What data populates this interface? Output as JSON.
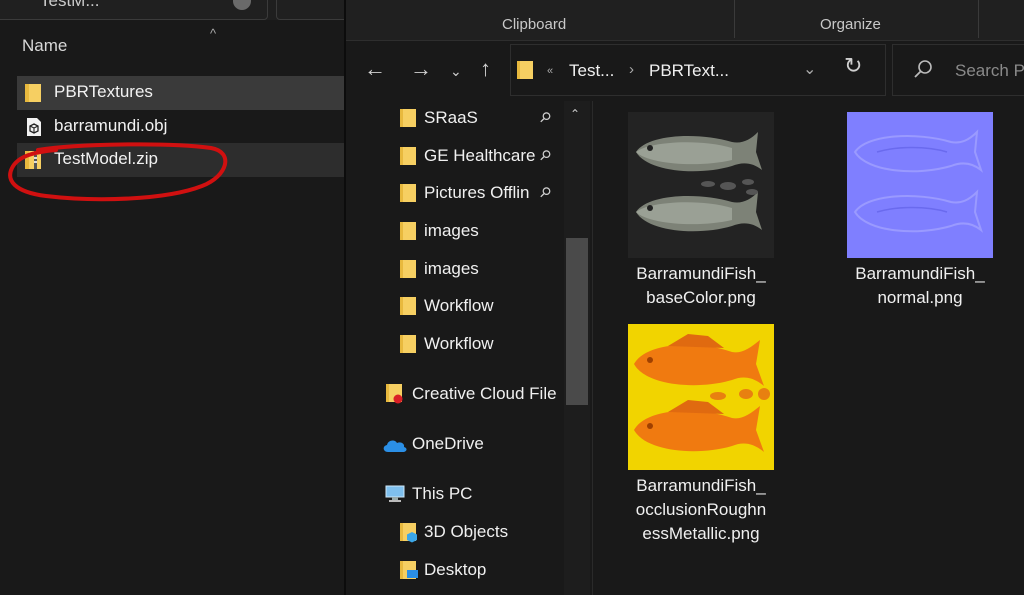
{
  "left_window": {
    "title_fragment": "TestM...",
    "column_header": "Name",
    "files": [
      {
        "name": "PBRTextures",
        "icon": "folder-icon"
      },
      {
        "name": "barramundi.obj",
        "icon": "3d-object-file-icon"
      },
      {
        "name": "TestModel.zip",
        "icon": "zip-folder-icon"
      }
    ],
    "annotation_color": "#d01010"
  },
  "right_window": {
    "ribbon": {
      "groups": [
        "Clipboard",
        "Organize"
      ]
    },
    "breadcrumb": [
      "Test...",
      "PBRText..."
    ],
    "search_placeholder": "Search P",
    "nav_items": [
      {
        "label": "SRaaS",
        "icon": "folder-icon",
        "pinned": true
      },
      {
        "label": "GE Healthcare",
        "icon": "folder-icon",
        "pinned": true
      },
      {
        "label": "Pictures Offlin",
        "icon": "folder-icon",
        "pinned": true
      },
      {
        "label": "images",
        "icon": "folder-icon",
        "pinned": false
      },
      {
        "label": "images",
        "icon": "folder-icon",
        "pinned": false
      },
      {
        "label": "Workflow",
        "icon": "folder-icon",
        "pinned": false
      },
      {
        "label": "Workflow",
        "icon": "folder-icon",
        "pinned": false
      },
      {
        "label": "Creative Cloud File",
        "icon": "creative-cloud-folder-icon",
        "pinned": false
      },
      {
        "label": "OneDrive",
        "icon": "onedrive-cloud-icon",
        "pinned": false
      },
      {
        "label": "This PC",
        "icon": "this-pc-icon",
        "pinned": false
      },
      {
        "label": "3D Objects",
        "icon": "3d-objects-folder-icon",
        "pinned": false
      },
      {
        "label": "Desktop",
        "icon": "desktop-folder-icon",
        "pinned": false
      }
    ],
    "files": [
      {
        "line1": "BarramundiFish_",
        "line2": "baseColor.png",
        "line3": ""
      },
      {
        "line1": "BarramundiFish_",
        "line2": "normal.png",
        "line3": ""
      },
      {
        "line1": "BarramundiFish_",
        "line2": "occlusionRoughn",
        "line3": "essMetallic.png"
      }
    ]
  }
}
